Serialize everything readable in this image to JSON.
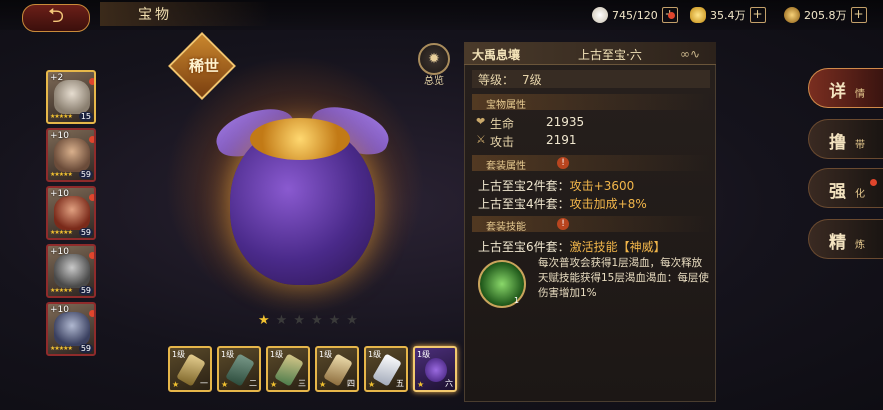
{
  "header": {
    "back_label": "⮌",
    "title": "宝物",
    "resources": [
      {
        "name": "stamina",
        "value": "745/120",
        "icon": "bun-icon",
        "color": "#e8e1d2"
      },
      {
        "name": "yuanbao",
        "value": "35.4万",
        "icon": "ingot-icon",
        "color": "#f2c230"
      },
      {
        "name": "coins",
        "value": "205.8万",
        "icon": "coin-icon",
        "color": "#d9a84a"
      }
    ],
    "plus": "+"
  },
  "heroes": [
    {
      "plus": "+2",
      "level": "15",
      "stars": "★★★★★",
      "selected": true
    },
    {
      "plus": "+10",
      "level": "59",
      "stars": "★★★★★",
      "selected": false
    },
    {
      "plus": "+10",
      "level": "59",
      "stars": "★★★★★",
      "selected": false
    },
    {
      "plus": "+10",
      "level": "59",
      "stars": "★★★★★",
      "selected": false
    },
    {
      "plus": "+10",
      "level": "59",
      "stars": "★★★★★",
      "selected": false
    }
  ],
  "item": {
    "rarity": "稀世",
    "overview_label": "总览",
    "stars_total": 6,
    "stars_filled": 1
  },
  "slots": [
    {
      "level": "1级",
      "index": "一",
      "selected": false
    },
    {
      "level": "1级",
      "index": "二",
      "selected": false
    },
    {
      "level": "1级",
      "index": "三",
      "selected": false
    },
    {
      "level": "1级",
      "index": "四",
      "selected": false
    },
    {
      "level": "1级",
      "index": "五",
      "selected": false
    },
    {
      "level": "1级",
      "index": "六",
      "selected": true
    }
  ],
  "panel": {
    "name": "大禹息壤",
    "grade": "上古至宝·六",
    "level_label": "等级：",
    "level_value": "7级",
    "attr_title": "宝物属性",
    "stats": [
      {
        "icon": "heart-icon",
        "label": "生命",
        "value": "21935"
      },
      {
        "icon": "sword-icon",
        "label": "攻击",
        "value": "2191"
      }
    ],
    "set_attr_title": "套装属性",
    "set_attrs": [
      {
        "label": "上古至宝2件套：",
        "effect": "攻击+3600"
      },
      {
        "label": "上古至宝4件套：",
        "effect": "攻击加成+8%"
      }
    ],
    "set_skill_title": "套装技能",
    "skill_line": {
      "label": "上古至宝6件套：",
      "effect": "激活技能【神威】"
    },
    "skill_level": "1",
    "skill_desc": "每次普攻会获得1层渴血，每次释放天赋技能获得15层渴血渴血：每层使伤害增加1%"
  },
  "tabs": [
    {
      "main": "详",
      "sub": "情",
      "active": true,
      "dot": false
    },
    {
      "main": "撸",
      "sub": "带",
      "active": false,
      "dot": false
    },
    {
      "main": "强",
      "sub": "化",
      "active": false,
      "dot": true
    },
    {
      "main": "精",
      "sub": "炼",
      "active": false,
      "dot": false
    }
  ]
}
